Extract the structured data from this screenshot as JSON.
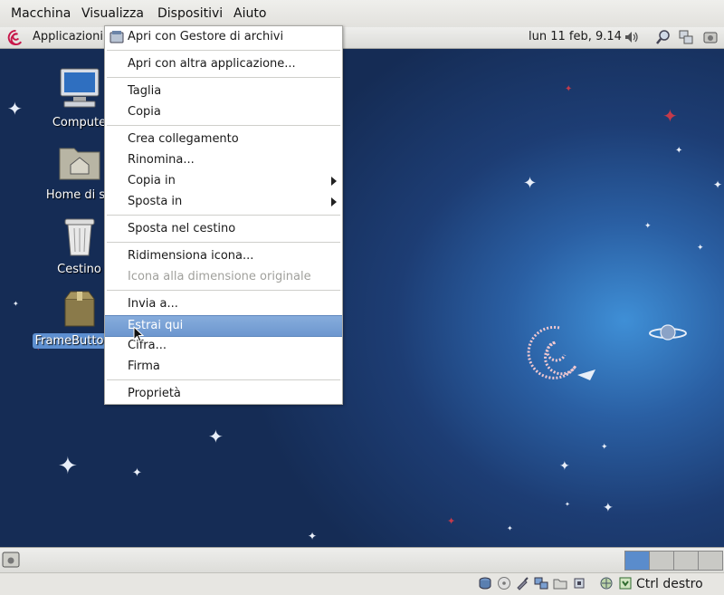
{
  "vbox_menu": {
    "items": [
      {
        "label": "Macchina",
        "accel": "M"
      },
      {
        "label": "Visualizza",
        "accel": "V"
      },
      {
        "label": "Dispositivi",
        "accel": "D"
      },
      {
        "label": "Aiuto",
        "accel": "A"
      }
    ]
  },
  "panel": {
    "apps_label": "Applicazioni",
    "clock": "lun 11 feb, 9.14"
  },
  "desktop_icons": [
    {
      "label": "Compute"
    },
    {
      "label": "Home di sa"
    },
    {
      "label": "Cestino"
    },
    {
      "label": "FrameButtonTe"
    }
  ],
  "context_menu": {
    "items": [
      {
        "label": "Apri con Gestore di archivi"
      },
      {
        "label": "Apri con altra applicazione..."
      },
      {
        "label": "Taglia"
      },
      {
        "label": "Copia"
      },
      {
        "label": "Crea collegamento"
      },
      {
        "label": "Rinomina..."
      },
      {
        "label": "Copia in"
      },
      {
        "label": "Sposta in"
      },
      {
        "label": "Sposta nel cestino"
      },
      {
        "label": "Ridimensiona icona..."
      },
      {
        "label": "Icona alla dimensione originale"
      },
      {
        "label": "Invia a..."
      },
      {
        "label": "Estrai qui"
      },
      {
        "label": "Cifra..."
      },
      {
        "label": "Firma"
      },
      {
        "label": "Proprietà"
      }
    ]
  },
  "statusbar": {
    "host_key": "Ctrl destro"
  }
}
